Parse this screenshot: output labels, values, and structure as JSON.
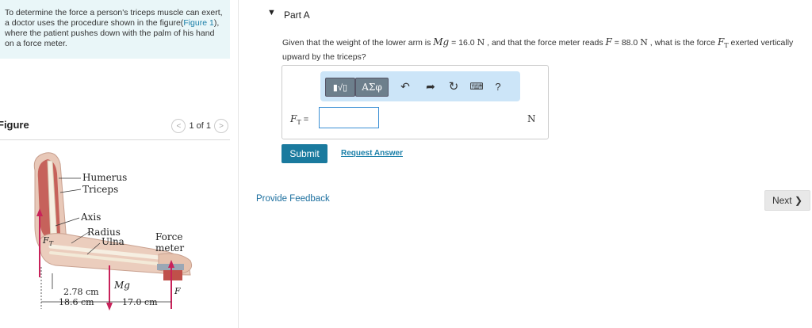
{
  "intro": {
    "text_before": "To determine the force a person's triceps muscle can exert, a doctor uses the procedure shown in the figure(",
    "link": "Figure 1",
    "text_after": "), where the patient pushes down with the palm of his hand on a force meter."
  },
  "figure": {
    "title": "Figure",
    "pager": "1 of 1",
    "prev": "<",
    "next": ">",
    "labels": {
      "humerus": "Humerus",
      "triceps": "Triceps",
      "axis": "Axis",
      "radius": "Radius",
      "ulna": "Ulna",
      "force": "Force",
      "meter": "meter",
      "ft": "F",
      "ft_sub": "T",
      "mg": "Mg",
      "f": "F",
      "d1": "2.78 cm",
      "d2": "18.6 cm",
      "d3": "17.0 cm"
    }
  },
  "part": {
    "title": "Part A",
    "toggle": "▼",
    "question": {
      "p1": "Given that the weight of the lower arm is ",
      "mg": "Mg",
      "p2": " = 16.0 ",
      "u1": "N",
      "p3": " , and that the force meter reads ",
      "f": "F",
      "p4": " = 88.0 ",
      "u2": "N",
      "p5": " , what is the force ",
      "ft": "F",
      "ft_sub": "T",
      "p6": " exerted vertically upward by the triceps?"
    },
    "toolbar": {
      "template": "▮√▯",
      "greek": "ΑΣφ",
      "undo": "↶",
      "redo": "➦",
      "reset": "↻",
      "keyboard": "⌨",
      "help": "?"
    },
    "answer_label": "F",
    "answer_sub": "T",
    "answer_eq": " =",
    "answer_value": "",
    "unit": "N",
    "submit": "Submit",
    "request": "Request Answer"
  },
  "feedback": "Provide Feedback",
  "next": "Next ❯"
}
